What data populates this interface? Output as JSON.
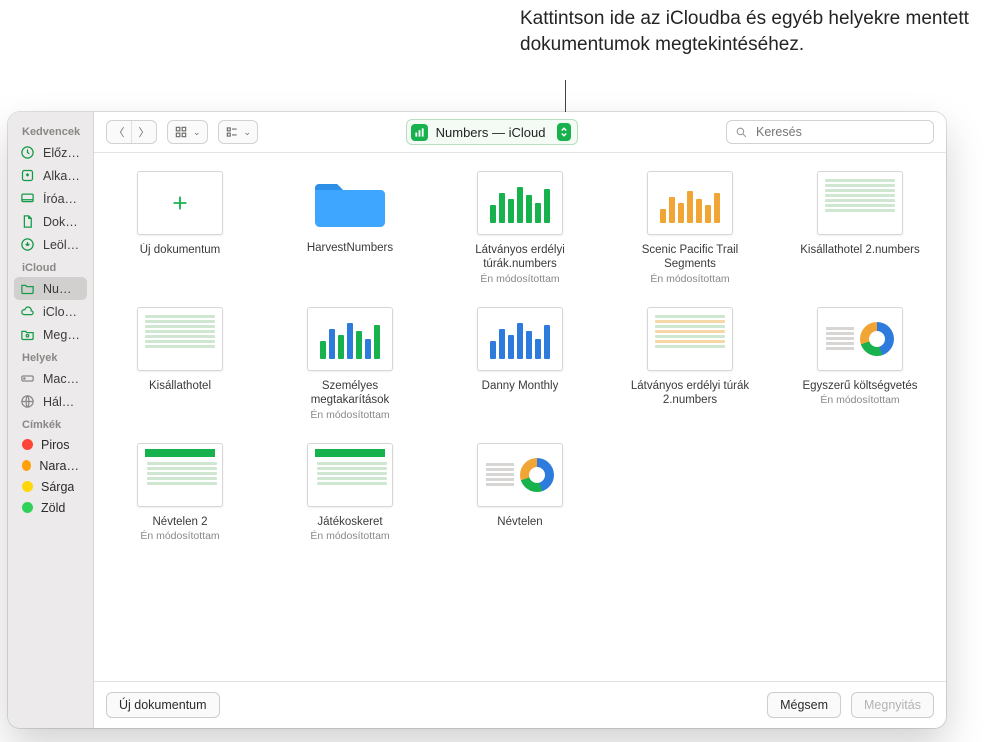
{
  "callout": "Kattintson ide az iCloudba és egyéb helyekre mentett dokumentumok megtekintéséhez.",
  "sidebar": {
    "sections": [
      {
        "header": "Kedvencek",
        "items": [
          {
            "icon": "clock",
            "label": "Előzmények",
            "color": "green"
          },
          {
            "icon": "app",
            "label": "Alkalmazások",
            "color": "green"
          },
          {
            "icon": "desktop",
            "label": "Íróasztal",
            "color": "green"
          },
          {
            "icon": "doc",
            "label": "Dokumentumo",
            "color": "green"
          },
          {
            "icon": "download",
            "label": "Leöltések",
            "color": "green"
          }
        ]
      },
      {
        "header": "iCloud",
        "items": [
          {
            "icon": "folder",
            "label": "Numbers",
            "color": "green",
            "selected": true
          },
          {
            "icon": "cloud",
            "label": "iCloud Drive",
            "color": "green"
          },
          {
            "icon": "shared",
            "label": "Megosztott",
            "color": "green"
          }
        ]
      },
      {
        "header": "Helyek",
        "items": [
          {
            "icon": "hdd",
            "label": "Macintosh HD",
            "color": "gray"
          },
          {
            "icon": "globe",
            "label": "Hálózat",
            "color": "gray"
          }
        ]
      }
    ],
    "tags_header": "Címkék",
    "tags": [
      {
        "label": "Piros",
        "hex": "#ff453a"
      },
      {
        "label": "Narancs",
        "hex": "#ff9f0a"
      },
      {
        "label": "Sárga",
        "hex": "#ffd60a"
      },
      {
        "label": "Zöld",
        "hex": "#30d158"
      }
    ]
  },
  "toolbar": {
    "location_label": "Numbers — iCloud",
    "search_placeholder": "Keresés"
  },
  "grid": {
    "rows": [
      [
        {
          "kind": "new",
          "title": "Új dokumentum"
        },
        {
          "kind": "folder",
          "title": "HarvestNumbers"
        },
        {
          "kind": "doc",
          "title": "Látványos erdélyi túrák.numbers",
          "sub": "Én módosítottam",
          "sketch": "bars-green"
        },
        {
          "kind": "doc",
          "title": "Scenic Pacific Trail Segments",
          "sub": "Én módosítottam",
          "sketch": "bars-orange"
        },
        {
          "kind": "doc",
          "title": "Kisállathotel 2.numbers",
          "sketch": "table-plain"
        }
      ],
      [
        {
          "kind": "doc",
          "title": "Kisállathotel",
          "sketch": "table-plain"
        },
        {
          "kind": "doc",
          "title": "Személyes megtakarítások",
          "sub": "Én módosítottam",
          "sketch": "bars-mixed"
        },
        {
          "kind": "doc",
          "title": "Danny Monthly",
          "sketch": "bars-blue"
        },
        {
          "kind": "doc",
          "title": "Látványos erdélyi túrák 2.numbers",
          "sketch": "table-orange"
        },
        {
          "kind": "doc",
          "title": "Egyszerű költségvetés",
          "sub": "Én módosítottam",
          "sketch": "donut"
        }
      ],
      [
        {
          "kind": "doc",
          "title": "Névtelen 2",
          "sub": "Én módosítottam",
          "sketch": "header-green"
        },
        {
          "kind": "doc",
          "title": "Játékoskeret",
          "sub": "Én módosítottam",
          "sketch": "header-green"
        },
        {
          "kind": "doc",
          "title": "Névtelen",
          "sketch": "donut"
        }
      ]
    ]
  },
  "footer": {
    "new_doc": "Új dokumentum",
    "cancel": "Mégsem",
    "open": "Megnyitás"
  },
  "colors": {
    "accent": "#17b24e"
  }
}
